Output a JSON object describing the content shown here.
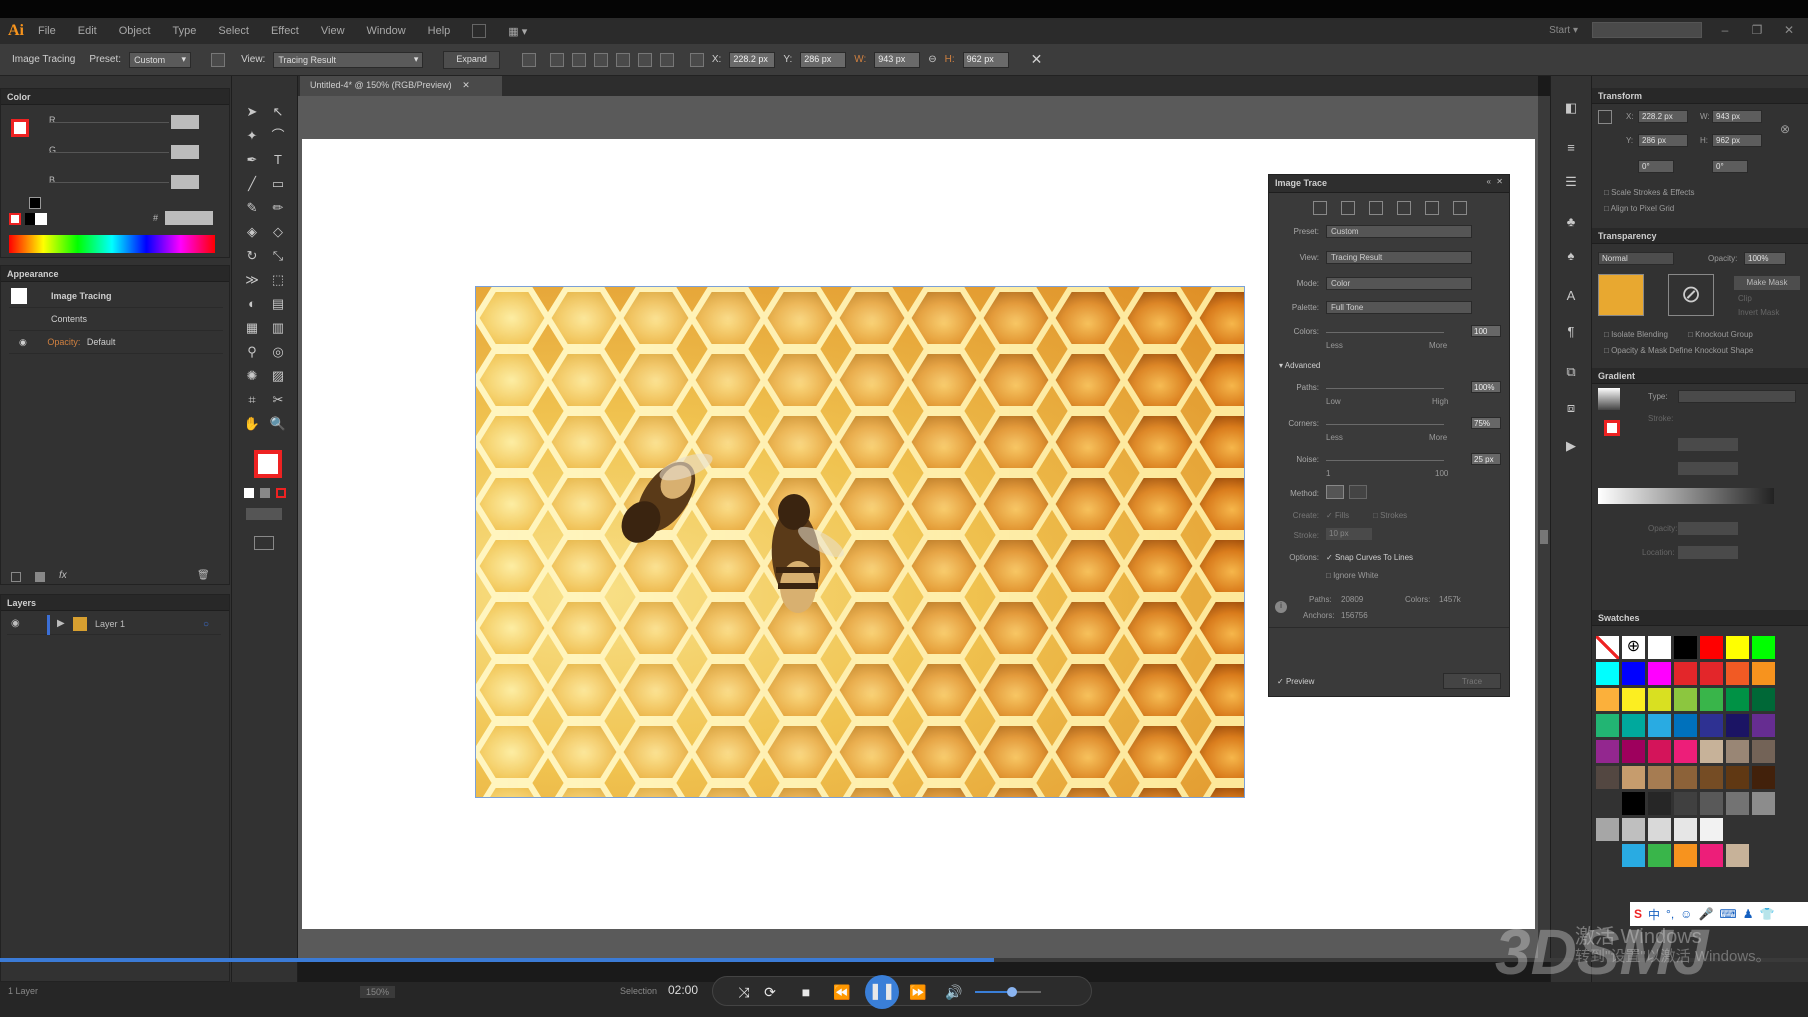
{
  "app": {
    "logo": "Ai",
    "menu": [
      "File",
      "Edit",
      "Object",
      "Type",
      "Select",
      "Effect",
      "View",
      "Window",
      "Help"
    ],
    "workspace": "Start ▾"
  },
  "control_bar": {
    "mode_label": "Image Tracing",
    "preset_label": "Preset:",
    "preset_value": "Custom",
    "view_label": "View:",
    "view_value": "Tracing Result",
    "expand_label": "Expand",
    "x_label": "X:",
    "x_value": "228.2 px",
    "y_label": "Y:",
    "y_value": "286 px",
    "w_label": "W:",
    "w_value": "943 px",
    "h_label": "H:",
    "h_value": "962 px"
  },
  "color_panel": {
    "title": "Color",
    "channels": [
      "R",
      "G",
      "B"
    ],
    "hex_prefix": "#"
  },
  "appearance_panel": {
    "title": "Appearance",
    "object_name": "Image Tracing",
    "contents": "Contents",
    "opacity_label": "Opacity:",
    "opacity_value": "Default"
  },
  "layers_panel": {
    "title": "Layers",
    "layer_name": "Layer 1",
    "footer": "1 Layer"
  },
  "document": {
    "tab_title": "Untitled-4* @ 150% (RGB/Preview)"
  },
  "image_trace": {
    "title": "Image Trace",
    "preset_label": "Preset:",
    "preset_value": "Custom",
    "view_label": "View:",
    "view_value": "Tracing Result",
    "mode_label": "Mode:",
    "mode_value": "Color",
    "palette_label": "Palette:",
    "palette_value": "Full Tone",
    "colors_label": "Colors:",
    "colors_value": "100",
    "less": "Less",
    "more": "More",
    "advanced": "Advanced",
    "paths_label": "Paths:",
    "paths_value": "100%",
    "low": "Low",
    "high": "High",
    "corners_label": "Corners:",
    "corners_value": "75%",
    "noise_label": "Noise:",
    "noise_value": "25 px",
    "noise_min": "1",
    "noise_max": "100",
    "method_label": "Method:",
    "create_label": "Create:",
    "fills": "Fills",
    "strokes": "Strokes",
    "stroke_label": "Stroke:",
    "stroke_value": "10 px",
    "options_label": "Options:",
    "snap": "Snap Curves To Lines",
    "ignore_white": "Ignore White",
    "stats_paths_label": "Paths:",
    "stats_paths_value": "20809",
    "stats_colors_label": "Colors:",
    "stats_colors_value": "1457k",
    "stats_anchors_label": "Anchors:",
    "stats_anchors_value": "156756",
    "preview": "Preview",
    "trace": "Trace"
  },
  "transform_panel": {
    "title": "Transform",
    "x_label": "X:",
    "x_value": "228.2 px",
    "y_label": "Y:",
    "y_value": "286 px",
    "w_label": "W:",
    "w_value": "943 px",
    "h_label": "H:",
    "h_value": "962 px",
    "angle_value": "0°",
    "shear_value": "0°",
    "scale_strokes": "Scale Strokes & Effects",
    "align_pixel": "Align to Pixel Grid"
  },
  "transparency_panel": {
    "title": "Transparency",
    "blend": "Normal",
    "opacity_label": "Opacity:",
    "opacity_value": "100%",
    "make_mask": "Make Mask",
    "clip": "Clip",
    "invert_mask": "Invert Mask",
    "isolate_blending": "Isolate Blending",
    "knockout_group": "Knockout Group",
    "opacity_mask": "Opacity & Mask Define Knockout Shape"
  },
  "gradient_panel": {
    "title": "Gradient",
    "type_label": "Type:",
    "stroke_label": "Stroke:",
    "opacity_label": "Opacity:",
    "location_label": "Location:"
  },
  "swatches_panel": {
    "title": "Swatches",
    "colors": [
      "#ffffff",
      "#ffffff",
      "#ffffff",
      "#000000",
      "#ff0000",
      "#ffff00",
      "#00ff00",
      "#00ffff",
      "#0000ff",
      "#ff00ff",
      "#e3262a",
      "#e3262a",
      "#f15a24",
      "#f7931e",
      "#fbb03b",
      "#fcee21",
      "#d9e021",
      "#8cc63f",
      "#39b54a",
      "#009245",
      "#006837",
      "#22b573",
      "#00a99d",
      "#29abe2",
      "#0071bc",
      "#2e3192",
      "#1b1464",
      "#662d91",
      "#93278f",
      "#9e005d",
      "#d4145a",
      "#ed1e79",
      "#c7b299",
      "#998675",
      "#736357",
      "#534741",
      "#c69c6d",
      "#a67c52",
      "#8c6239",
      "#754c24",
      "#603813",
      "#42210b"
    ],
    "gray_row": [
      "#000000",
      "#262626",
      "#404040",
      "#595959",
      "#737373",
      "#8c8c8c"
    ],
    "light_row": [
      "#a6a6a6",
      "#bfbfbf",
      "#d9d9d9",
      "#e6e6e6",
      "#f2f2f2"
    ],
    "last_row": [
      "#29abe2",
      "#39b54a",
      "#f7931e",
      "#ed1e79",
      "#c7b299"
    ]
  },
  "status": {
    "zoom": "150%",
    "tool": "Selection"
  },
  "player": {
    "time": "02:00",
    "progress": 0.55
  },
  "watermark": {
    "line1": "激活 Windows",
    "line2": "转到\"设置\"以激活 Windows。",
    "brand": "3DSMJ"
  }
}
